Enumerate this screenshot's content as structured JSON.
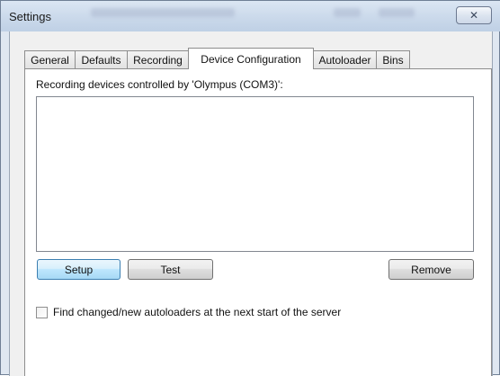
{
  "window": {
    "title": "Settings",
    "close_label": "✕"
  },
  "tabs": [
    {
      "label": "General",
      "active": false
    },
    {
      "label": "Defaults",
      "active": false
    },
    {
      "label": "Recording",
      "active": false
    },
    {
      "label": "Device Configuration",
      "active": true
    },
    {
      "label": "Autoloader",
      "active": false
    },
    {
      "label": "Bins",
      "active": false
    }
  ],
  "panel": {
    "caption": "Recording devices controlled by 'Olympus (COM3)':",
    "devices": [],
    "buttons": {
      "setup": "Setup",
      "test": "Test",
      "remove": "Remove"
    },
    "checkbox": {
      "label": "Find changed/new autoloaders at the next start of the server",
      "checked": false
    }
  }
}
